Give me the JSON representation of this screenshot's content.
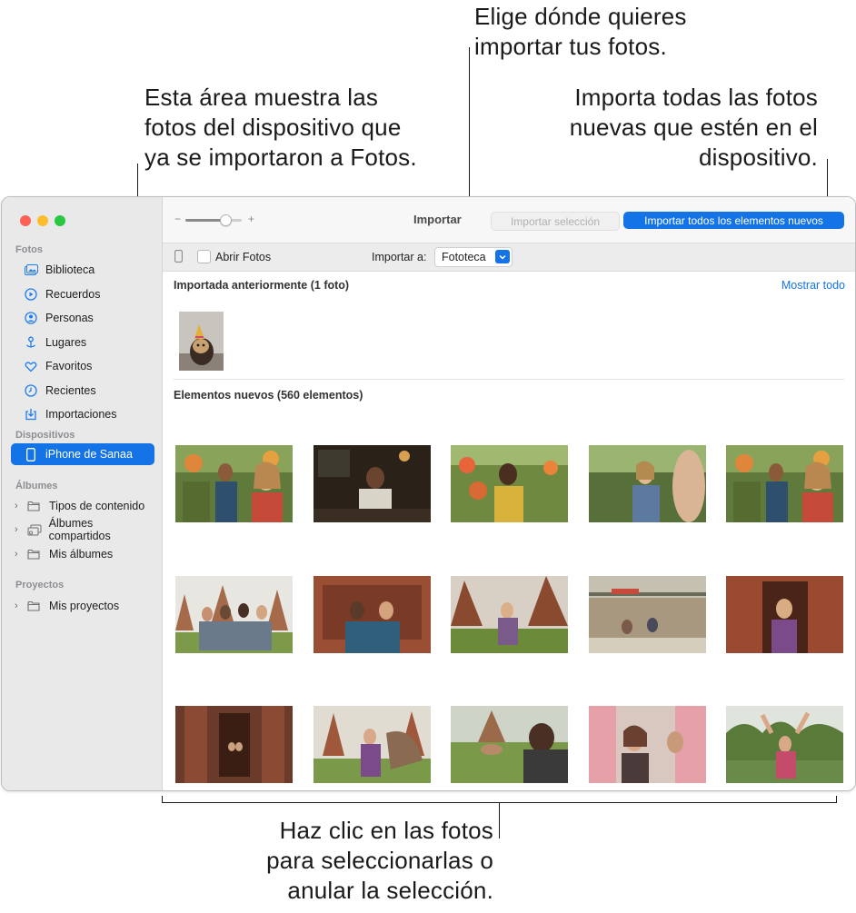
{
  "callouts": {
    "preimported": [
      "Esta área muestra las",
      "fotos del dispositivo que",
      "ya se importaron a Fotos."
    ],
    "destination": [
      "Elige dónde quieres",
      "importar tus fotos."
    ],
    "import_all": [
      "Importa todas las fotos",
      "nuevas que estén en el",
      "dispositivo."
    ],
    "select": [
      "Haz clic en las fotos",
      "para seleccionarlas o",
      "anular la selección."
    ]
  },
  "toolbar": {
    "title": "Importar",
    "zoom_minus": "−",
    "zoom_plus": "+",
    "zoom_level": 0.75,
    "import_selected_label": "Importar selección",
    "import_all_label": "Importar todos los elementos nuevos"
  },
  "subbar": {
    "open_photos_label": "Abrir Fotos",
    "open_photos_checked": false,
    "import_to_label": "Importar a:",
    "import_to_value": "Fototeca"
  },
  "sidebar": {
    "sections": {
      "fotos": "Fotos",
      "dispositivos": "Dispositivos",
      "albumes": "Álbumes",
      "proyectos": "Proyectos"
    },
    "fotos_items": [
      {
        "label": "Biblioteca",
        "icon": "photo-library-icon"
      },
      {
        "label": "Recuerdos",
        "icon": "memories-icon"
      },
      {
        "label": "Personas",
        "icon": "people-icon"
      },
      {
        "label": "Lugares",
        "icon": "places-pin-icon"
      },
      {
        "label": "Favoritos",
        "icon": "heart-icon"
      },
      {
        "label": "Recientes",
        "icon": "clock-icon"
      },
      {
        "label": "Importaciones",
        "icon": "import-icon"
      }
    ],
    "device": {
      "label": "iPhone de Sanaa",
      "icon": "iphone-icon"
    },
    "album_groups": [
      {
        "label": "Tipos de contenido",
        "icon": "folder-icon"
      },
      {
        "label": "Álbumes compartidos",
        "icon": "shared-albums-icon"
      },
      {
        "label": "Mis álbumes",
        "icon": "folder-icon"
      }
    ],
    "project_groups": [
      {
        "label": "Mis proyectos",
        "icon": "folder-icon"
      }
    ]
  },
  "content": {
    "previously_imported_title": "Importada anteriormente (1 foto)",
    "show_all_label": "Mostrar todo",
    "new_items_title": "Elementos nuevos (560 elementos)"
  },
  "colors": {
    "accent": "#1473e6",
    "sidebar_bg": "#e9e9ea",
    "traffic_red": "#fe5f57",
    "traffic_yellow": "#febc2e",
    "traffic_green": "#28c840"
  }
}
